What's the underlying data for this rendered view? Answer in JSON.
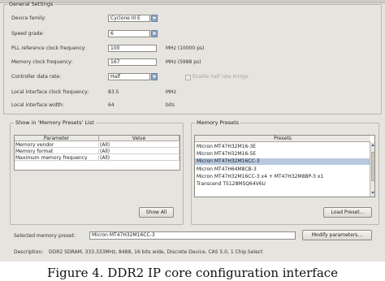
{
  "general_settings": {
    "legend": "General Settings",
    "rows": [
      {
        "label": "Device family:",
        "value": "Cyclone III E",
        "unit": ""
      },
      {
        "label": "Speed grade:",
        "value": "6",
        "unit": ""
      },
      {
        "label": "PLL reference clock frequency:",
        "value": "100",
        "unit": "MHz  (10000 ps)"
      },
      {
        "label": "Memory clock frequency:",
        "value": "167",
        "unit": "MHz  (5988 ps)"
      },
      {
        "label": "Controller data rate:",
        "value": "Half",
        "unit": ""
      },
      {
        "label": "Local interface clock frequency:",
        "value": "83.5",
        "unit": "MHz"
      },
      {
        "label": "Local interface width:",
        "value": "64",
        "unit": "bits"
      }
    ],
    "checkbox_label": "Enable half rate bridge"
  },
  "memory_presets_list": {
    "legend": "Show in 'Memory Presets' List",
    "columns": [
      "Parameter",
      "Value"
    ],
    "rows": [
      [
        "Memory vendor",
        "(All)"
      ],
      [
        "Memory format",
        "(All)"
      ],
      [
        "Maximum memory frequency",
        "(All)"
      ]
    ],
    "show_all_button": "Show All"
  },
  "memory_presets": {
    "legend": "Memory Presets",
    "column": "Presets",
    "items": [
      "Micron MT47H32M16-3E",
      "Micron MT47H32M16-5E",
      "Micron MT47H32M16CC-3",
      "Micron MT47H64M8CB-3",
      "Micron MT47H32M16CC-3 x4 + MT47H32M8BP-3 x1",
      "Transcend TS128MSQ64V6U"
    ],
    "selected_index": 2,
    "load_preset_button": "Load Preset..."
  },
  "selected_memory_preset": {
    "label": "Selected memory preset:",
    "value": "Micron MT47H32M16CC-3",
    "modify_button": "Modify parameters..."
  },
  "description": {
    "label": "Description:",
    "text": "DDR2 SDRAM, 333.333MHz, 8488, 16 bits wide, Discrete Device, CAS 5.0, 1 Chip Select"
  },
  "caption": "Figure 4. DDR2 IP core configuration interface"
}
